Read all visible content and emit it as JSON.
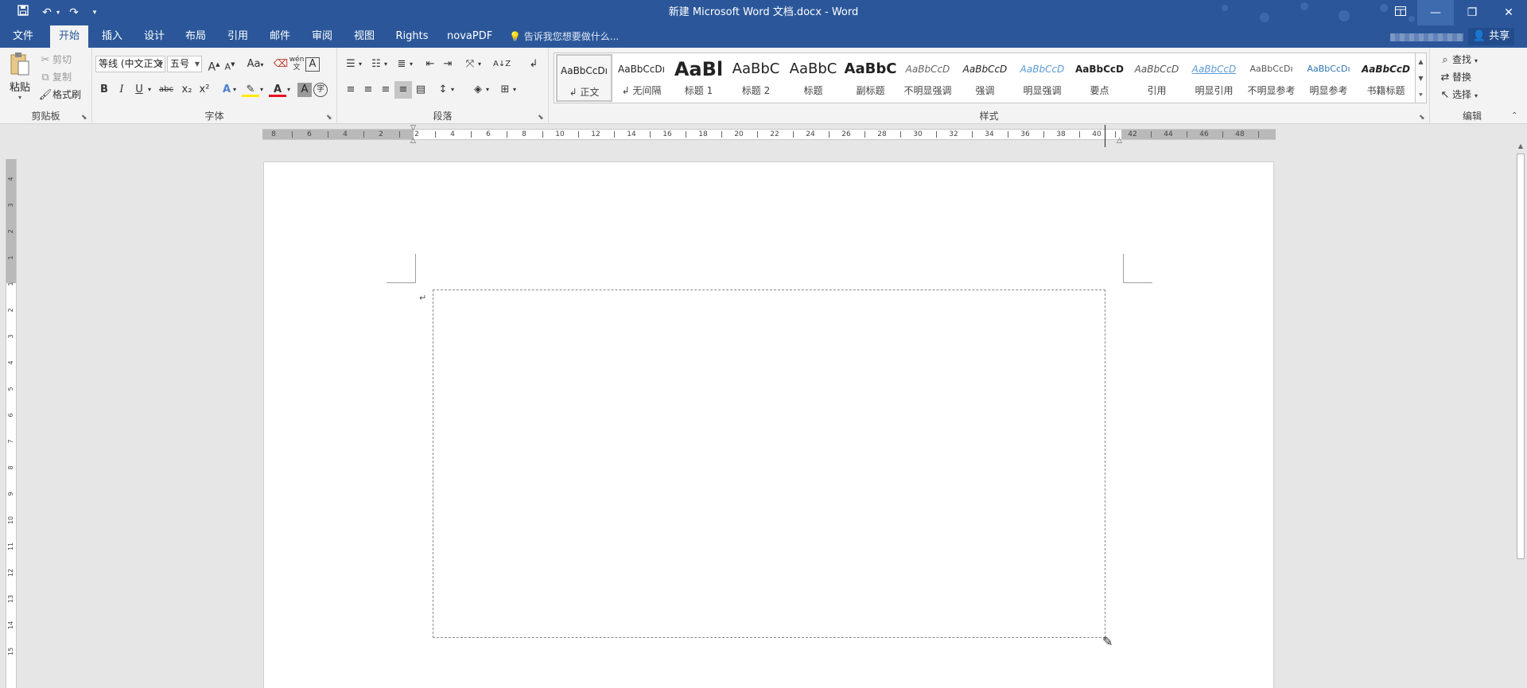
{
  "window": {
    "title": "新建 Microsoft Word 文档.docx - Word",
    "quick_access": [
      "save-icon",
      "undo-icon",
      "redo-icon",
      "customize-qat-icon"
    ],
    "controls": [
      "ribbon-display-icon",
      "minimize-icon",
      "restore-icon",
      "close-icon"
    ]
  },
  "tabs": [
    "文件",
    "开始",
    "插入",
    "设计",
    "布局",
    "引用",
    "邮件",
    "审阅",
    "视图",
    "Rights",
    "novaPDF"
  ],
  "active_tab": "开始",
  "tell_me": "告诉我您想要做什么...",
  "share": "共享",
  "clipboard": {
    "paste": "粘贴",
    "cut": "剪切",
    "copy": "复制",
    "format_painter": "格式刷",
    "label": "剪贴板"
  },
  "font": {
    "font_name": "等线 (中文正文",
    "font_size": "五号",
    "grow": "A",
    "shrink": "A",
    "change_case": "Aa",
    "bold": "B",
    "italic": "I",
    "underline": "U",
    "strikethrough": "abc",
    "subscript": "x₂",
    "superscript": "x²",
    "label": "字体",
    "pinyin": "wén",
    "char_border": "A",
    "font_color": "A",
    "char_shading": "A",
    "enclose": "字"
  },
  "paragraph": {
    "label": "段落"
  },
  "styles": {
    "label": "样式",
    "items": [
      {
        "sample": "AaBbCcDı",
        "name": "↲ 正文"
      },
      {
        "sample": "AaBbCcDı",
        "name": "↲ 无间隔"
      },
      {
        "sample": "AaBl",
        "name": "标题 1"
      },
      {
        "sample": "AaBbC",
        "name": "标题 2"
      },
      {
        "sample": "AaBbC",
        "name": "标题"
      },
      {
        "sample": "AaBbC",
        "name": "副标题"
      },
      {
        "sample": "AaBbCcD",
        "name": "不明显强调"
      },
      {
        "sample": "AaBbCcD",
        "name": "强调"
      },
      {
        "sample": "AaBbCcD",
        "name": "明显强调"
      },
      {
        "sample": "AaBbCcD",
        "name": "要点"
      },
      {
        "sample": "AaBbCcD",
        "name": "引用"
      },
      {
        "sample": "AaBbCcD",
        "name": "明显引用"
      },
      {
        "sample": "AaBbCcDı",
        "name": "不明显参考"
      },
      {
        "sample": "AaBbCcDı",
        "name": "明显参考"
      },
      {
        "sample": "AaBbCcD",
        "name": "书籍标题"
      }
    ]
  },
  "editing": {
    "find": "查找",
    "replace": "替换",
    "select": "选择",
    "label": "编辑"
  },
  "ruler": {
    "horizontal_labels": [
      "8",
      "6",
      "4",
      "2",
      "2",
      "4",
      "6",
      "8",
      "10",
      "12",
      "14",
      "16",
      "18",
      "20",
      "22",
      "24",
      "26",
      "28",
      "30",
      "32",
      "34",
      "36",
      "38",
      "40",
      "42",
      "44",
      "46",
      "48"
    ],
    "vertical_labels": [
      "4",
      "3",
      "2",
      "1",
      "1",
      "2",
      "3",
      "4",
      "5",
      "6",
      "7",
      "8",
      "9",
      "10",
      "11",
      "12",
      "13",
      "14",
      "15"
    ]
  },
  "document": {
    "paragraph_mark": "↵"
  }
}
